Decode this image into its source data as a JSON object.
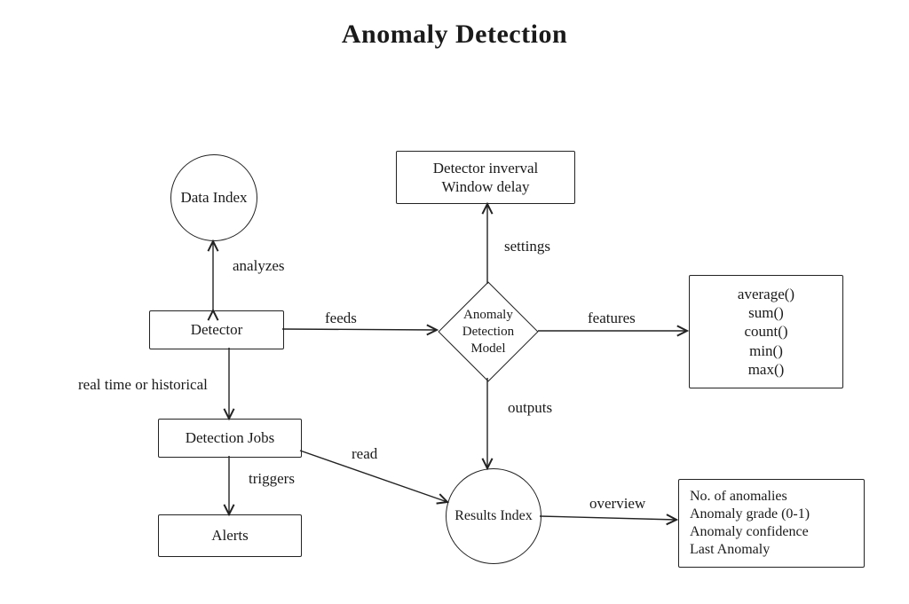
{
  "title": "Anomaly Detection",
  "nodes": {
    "data_index": "Data Index",
    "detector": "Detector",
    "detection_jobs": "Detection Jobs",
    "alerts": "Alerts",
    "interval_box": "Detector inverval\nWindow delay",
    "model": "Anomaly\nDetection\nModel",
    "features_box": "average()\nsum()\ncount()\nmin()\nmax()",
    "results_index": "Results Index",
    "overview_box": "No. of  anomalies\nAnomaly grade (0-1)\nAnomaly confidence\nLast Anomaly"
  },
  "edges": {
    "analyzes": "analyzes",
    "feeds": "feeds",
    "realtime": "real time or historical",
    "triggers": "triggers",
    "settings": "settings",
    "features": "features",
    "outputs": "outputs",
    "read": "read",
    "overview": "overview"
  }
}
